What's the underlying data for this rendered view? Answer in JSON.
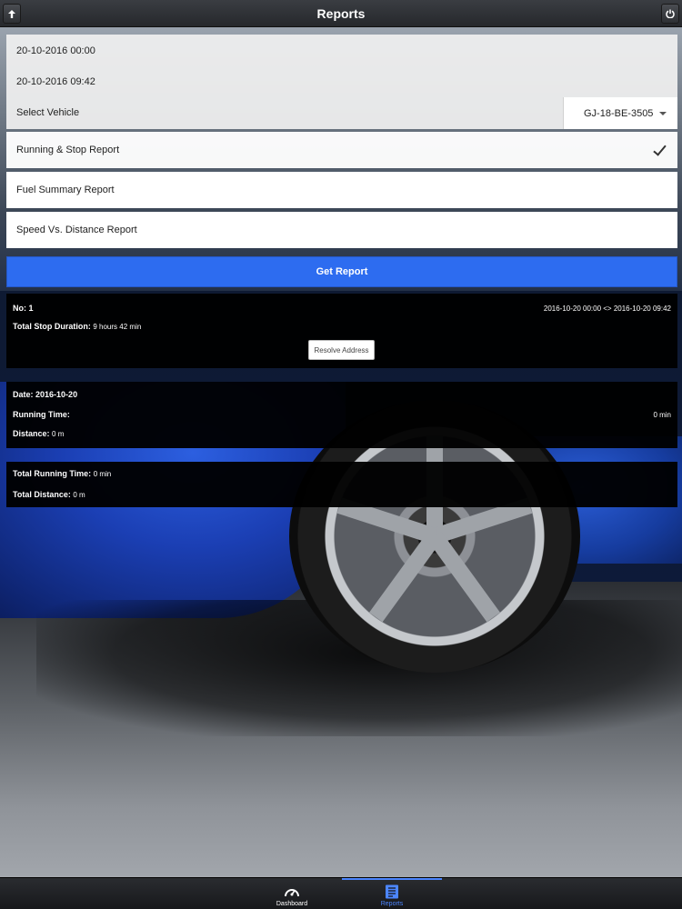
{
  "header": {
    "title": "Reports",
    "left_icon": "up-arrow-icon",
    "right_icon": "power-icon"
  },
  "form": {
    "from_date": "20-10-2016 00:00",
    "to_date": "20-10-2016 09:42",
    "vehicle_label": "Select Vehicle",
    "vehicle_value": "GJ-18-BE-3505"
  },
  "report_options": [
    {
      "label": "Running & Stop Report",
      "selected": true
    },
    {
      "label": "Fuel Summary Report",
      "selected": false
    },
    {
      "label": "Speed Vs. Distance Report",
      "selected": false
    }
  ],
  "get_report_label": "Get Report",
  "stop_panel": {
    "no_label": "No:",
    "no_value": "1",
    "date_range": "2016-10-20 00:00 <> 2016-10-20 09:42",
    "duration_label": "Total Stop Duration:",
    "duration_value": "9 hours 42 min",
    "resolve_label": "Resolve Address"
  },
  "day_panel": {
    "date_label": "Date:",
    "date_value": "2016-10-20",
    "running_label": "Running Time:",
    "running_value": "0 min",
    "distance_label": "Distance:",
    "distance_value": "0 m"
  },
  "total_panel": {
    "running_label": "Total Running Time:",
    "running_value": "0 min",
    "distance_label": "Total Distance:",
    "distance_value": "0 m"
  },
  "tabbar": {
    "dashboard_label": "Dashboard",
    "reports_label": "Reports",
    "active_color": "#4c86ff"
  },
  "colors": {
    "primary_button": "#2d6cf0",
    "header_bg": "#2f3135"
  }
}
